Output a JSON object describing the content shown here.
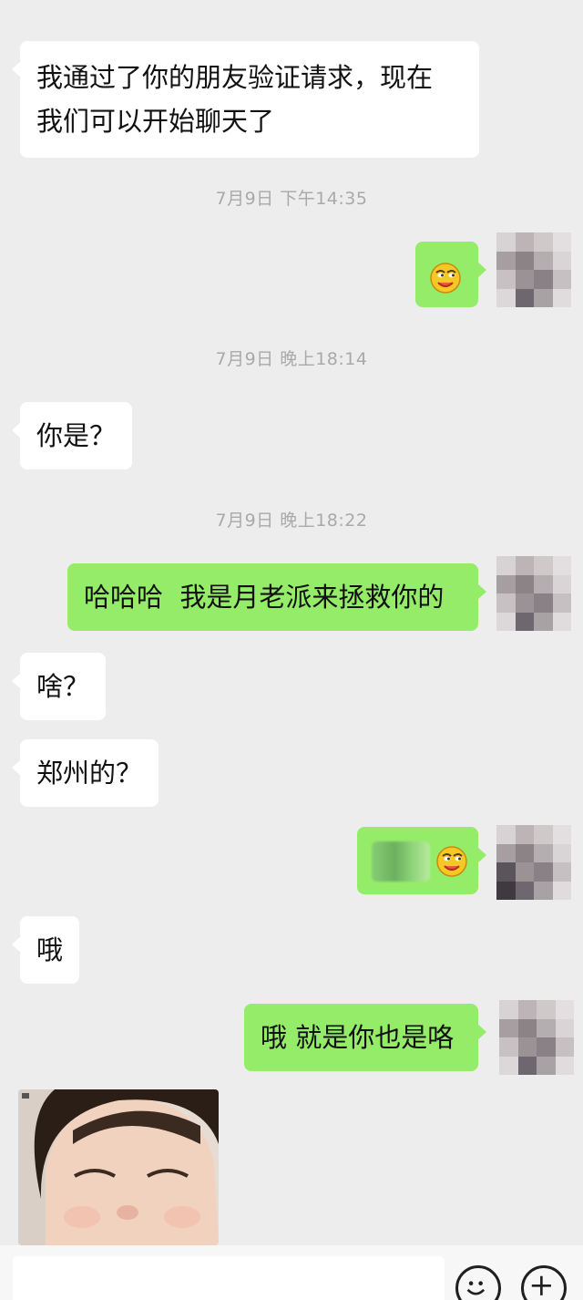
{
  "timestamps": [
    "7月9日 下午14:35",
    "7月9日 晚上18:14",
    "7月9日 晚上18:22"
  ],
  "messages": [
    {
      "side": "in",
      "text_line1": "我通过了你的朋友验证请求，现在",
      "text_line2": "我们可以开始聊天了"
    },
    {
      "side": "out",
      "emoji": "smirk-emoji"
    },
    {
      "side": "in",
      "text": "你是？"
    },
    {
      "side": "out",
      "text": "哈哈哈  我是月老派来拯救你的"
    },
    {
      "side": "in",
      "text": "啥？"
    },
    {
      "side": "in",
      "text": "郑州的？"
    },
    {
      "side": "out",
      "blurred_text": true,
      "emoji": "smirk-emoji"
    },
    {
      "side": "in",
      "text": "哦"
    },
    {
      "side": "out",
      "text": "哦 就是你也是咯"
    },
    {
      "side": "in",
      "image": "child-photo"
    }
  ],
  "bottom_bar": {
    "emoji_button_icon": "smiley-face-icon",
    "more_button_icon": "plus-icon"
  },
  "colors": {
    "background": "#ededed",
    "incoming_bubble": "#ffffff",
    "outgoing_bubble": "#95ec69",
    "timestamp": "#a9a9a9"
  }
}
